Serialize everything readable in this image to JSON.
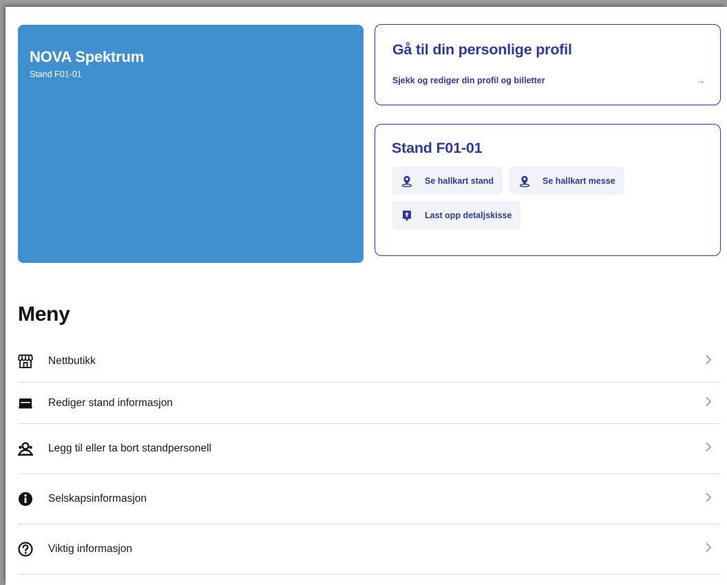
{
  "colors": {
    "brand_blue": "#408fcf",
    "navy": "#2d3a9a",
    "button_bg": "#f1f3f9"
  },
  "exhibitor": {
    "name": "NOVA Spektrum",
    "stand": "Stand F01-01"
  },
  "profile_card": {
    "title": "Gå til din personlige profil",
    "link_text": "Sjekk og rediger din profil og billetter",
    "arrow": "→"
  },
  "stand_card": {
    "title": "Stand F01-01",
    "actions": [
      {
        "label": "Se hallkart stand",
        "icon": "map-pin-icon"
      },
      {
        "label": "Se hallkart messe",
        "icon": "map-pin-icon"
      },
      {
        "label": "Last opp detaljskisse",
        "icon": "upload-icon"
      }
    ]
  },
  "menu": {
    "title": "Meny",
    "items": [
      {
        "label": "Nettbutikk",
        "icon": "storefront-icon"
      },
      {
        "label": "Rediger stand informasjon",
        "icon": "stand-icon"
      },
      {
        "label": "Legg til eller ta bort standpersonell",
        "icon": "people-icon"
      },
      {
        "label": "Selskapsinformasjon",
        "icon": "info-icon"
      },
      {
        "label": "Viktig informasjon",
        "icon": "question-icon"
      }
    ]
  }
}
